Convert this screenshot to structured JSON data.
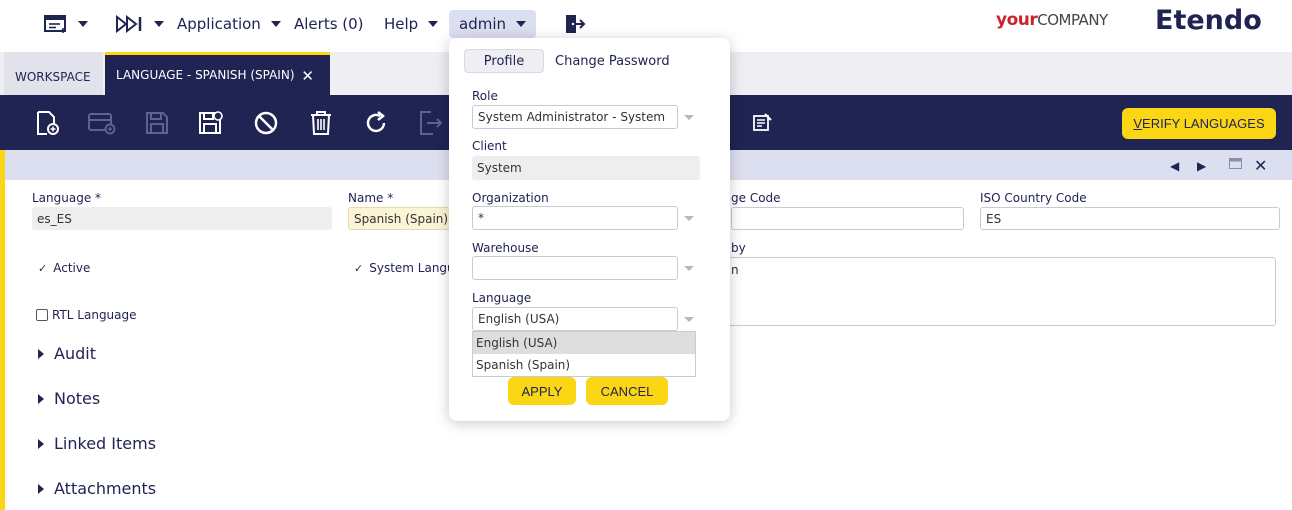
{
  "nav": {
    "application_label": "Application",
    "alerts_label": "Alerts (0)",
    "help_label": "Help",
    "user_label": "admin"
  },
  "branding": {
    "your_bold": "your",
    "your_rest": "COMPANY",
    "product": "Etendo"
  },
  "tabs": {
    "workspace": "WORKSPACE",
    "active": "LANGUAGE - SPANISH (SPAIN)"
  },
  "toolbar": {
    "verify_prefix": "V",
    "verify_rest": "ERIFY LANGUAGES"
  },
  "form": {
    "language_label": "Language *",
    "language_value": "es_ES",
    "name_label": "Name *",
    "name_value": "Spanish (Spain)",
    "lang_code_label": "ge Code",
    "iso_country_label": "ISO Country Code",
    "iso_country_value": "ES",
    "active_label": "Active",
    "system_language_label": "System Langu",
    "translated_by_label": "by",
    "translated_by_value": "n",
    "rtl_label": "RTL Language"
  },
  "sections": [
    "Audit",
    "Notes",
    "Linked Items",
    "Attachments"
  ],
  "profile_popup": {
    "tab_profile": "Profile",
    "tab_change_password": "Change Password",
    "role_label": "Role",
    "role_value": "System Administrator - System",
    "client_label": "Client",
    "client_value": "System",
    "organization_label": "Organization",
    "organization_value": "*",
    "warehouse_label": "Warehouse",
    "warehouse_value": "",
    "language_label": "Language",
    "language_value": "English (USA)",
    "language_options": [
      "English (USA)",
      "Spanish (Spain)"
    ],
    "apply_label": "APPLY",
    "cancel_label": "CANCEL"
  },
  "colors": {
    "brand_navy": "#202452",
    "accent_yellow": "#fad614",
    "brand_red": "#c9242b"
  },
  "icons": {
    "window_menu": "window-menu-icon",
    "quick_launch": "quick-launch-icon",
    "logout": "logout-icon",
    "new_document": "new-document-icon",
    "new_row": "new-row-icon",
    "save": "save-icon",
    "save_close": "save-close-icon",
    "undo": "undo-icon",
    "delete": "delete-icon",
    "refresh": "refresh-icon",
    "export": "export-icon",
    "report": "report-icon",
    "prev_record": "prev-record-icon",
    "next_record": "next-record-icon",
    "maximize": "maximize-icon",
    "close_form": "close-form-icon"
  }
}
